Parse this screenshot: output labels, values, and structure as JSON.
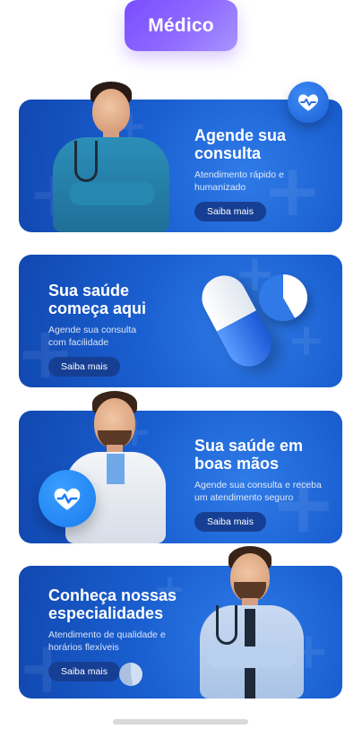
{
  "tag": {
    "label": "Médico"
  },
  "cards": [
    {
      "title_line1": "Agende sua",
      "title_line2": "consulta",
      "desc_line1": "Atendimento rápido e",
      "desc_line2": "humanizado",
      "button": "Saiba mais"
    },
    {
      "title_line1": "Sua saúde",
      "title_line2": "começa aqui",
      "desc_line1": "Agende sua consulta",
      "desc_line2": "com facilidade",
      "button": "Saiba mais"
    },
    {
      "title_line1": "Sua saúde em",
      "title_line2": "boas mãos",
      "desc_line1": "Agende sua consulta e receba",
      "desc_line2": "um atendimento seguro",
      "button": "Saiba mais"
    },
    {
      "title_line1": "Conheça nossas",
      "title_line2": "especialidades",
      "desc_line1": "Atendimento de qualidade e",
      "desc_line2": "horários flexíveis",
      "button": "Saiba mais"
    }
  ],
  "icons": [
    "heart-pulse-icon",
    "pill-icon",
    "plus-icon"
  ],
  "colors": {
    "tag": "#8a63ff",
    "card": "#1a5fd0",
    "button": "#163f93"
  }
}
